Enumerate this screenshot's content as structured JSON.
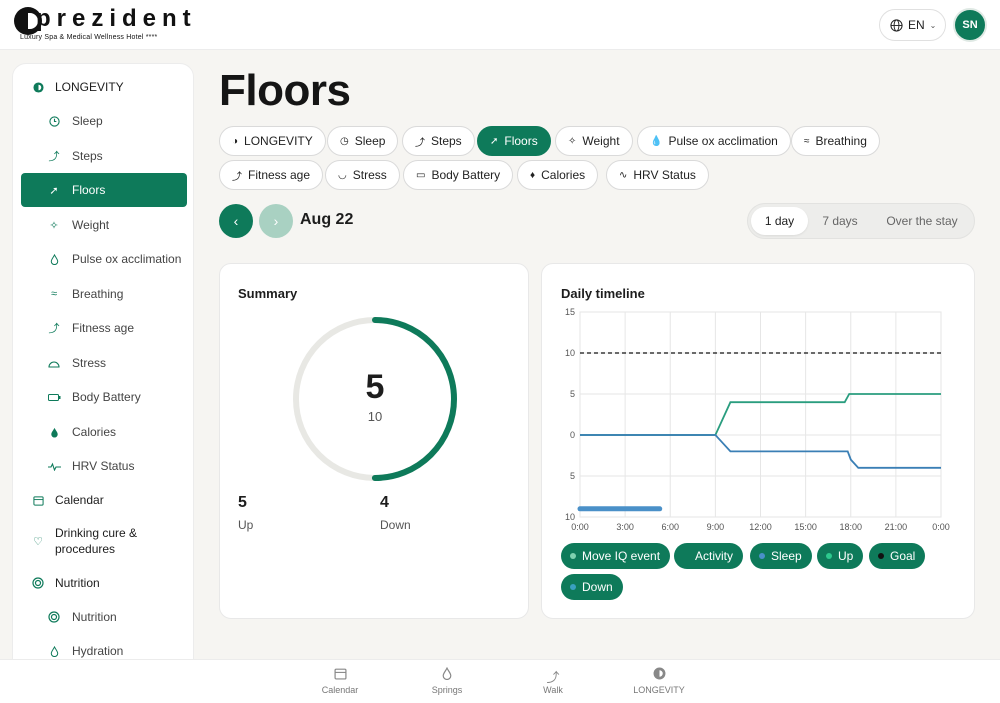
{
  "header": {
    "logo_text": "prezident",
    "tagline": "Luxury Spa & Medical Wellness Hotel ****",
    "language": "EN",
    "avatar_initials": "SN"
  },
  "sidebar": {
    "items": [
      {
        "label": "LONGEVITY",
        "icon": "longevity-icon"
      },
      {
        "label": "Sleep",
        "icon": "clock-icon"
      },
      {
        "label": "Steps",
        "icon": "walk-icon"
      },
      {
        "label": "Floors",
        "icon": "stairs-icon"
      },
      {
        "label": "Weight",
        "icon": "weight-icon"
      },
      {
        "label": "Pulse ox acclimation",
        "icon": "drop-icon"
      },
      {
        "label": "Breathing",
        "icon": "breathing-icon"
      },
      {
        "label": "Fitness age",
        "icon": "runner-icon"
      },
      {
        "label": "Stress",
        "icon": "gauge-icon"
      },
      {
        "label": "Body Battery",
        "icon": "battery-icon"
      },
      {
        "label": "Calories",
        "icon": "flame-icon"
      },
      {
        "label": "HRV Status",
        "icon": "pulse-icon"
      },
      {
        "label": "Calendar",
        "icon": "calendar-icon"
      },
      {
        "label": "Drinking cure & procedures",
        "icon": "heart-icon"
      },
      {
        "label": "Nutrition",
        "icon": "target-icon"
      },
      {
        "label": "Nutrition",
        "icon": "target-icon"
      },
      {
        "label": "Hydration",
        "icon": "drop-icon"
      }
    ]
  },
  "main": {
    "title": "Floors",
    "chips": [
      "LONGEVITY",
      "Sleep",
      "Steps",
      "Floors",
      "Weight",
      "Pulse ox acclimation",
      "Breathing",
      "Fitness age",
      "Stress",
      "Body Battery",
      "Calories",
      "HRV Status"
    ],
    "date": "Aug 22",
    "range_options": [
      "1 day",
      "7 days",
      "Over the stay"
    ],
    "selected_range": "1 day"
  },
  "summary": {
    "title": "Summary",
    "value": "5",
    "goal": "10",
    "progress": 0.5,
    "up_value": "5",
    "up_label": "Up",
    "down_value": "4",
    "down_label": "Down"
  },
  "timeline": {
    "title": "Daily timeline",
    "legend": [
      {
        "label": "Move IQ event",
        "dot": "#7fd1b0"
      },
      {
        "label": "Activity",
        "dot": "#0e7a5a"
      },
      {
        "label": "Sleep",
        "dot": "#4a90c8"
      },
      {
        "label": "Up",
        "dot": "#2dc98e"
      },
      {
        "label": "Goal",
        "dot": "#111111"
      },
      {
        "label": "Down",
        "dot": "#3aa0c0"
      }
    ]
  },
  "chart_data": {
    "type": "line",
    "title": "Daily timeline",
    "x_ticks": [
      "0:00",
      "3:00",
      "6:00",
      "9:00",
      "12:00",
      "15:00",
      "18:00",
      "21:00",
      "0:00"
    ],
    "y_ticks": [
      "15",
      "10",
      "5",
      "0",
      "5",
      "10"
    ],
    "xlim_hours": [
      0,
      24
    ],
    "ylim": [
      -10,
      15
    ],
    "grid": true,
    "series": [
      {
        "name": "Up",
        "color": "#2a9d7f",
        "points": [
          [
            0,
            0
          ],
          [
            9,
            0
          ],
          [
            10,
            4
          ],
          [
            17.6,
            4
          ],
          [
            17.9,
            5
          ],
          [
            24,
            5
          ]
        ]
      },
      {
        "name": "Down",
        "color": "#3a7fb5",
        "points": [
          [
            0,
            0
          ],
          [
            9,
            0
          ],
          [
            9.5,
            -1
          ],
          [
            10,
            -2
          ],
          [
            17.8,
            -2
          ],
          [
            18,
            -3
          ],
          [
            18.5,
            -4
          ],
          [
            24,
            -4
          ]
        ]
      },
      {
        "name": "Goal",
        "color": "#111111",
        "dashed": true,
        "points": [
          [
            0,
            10
          ],
          [
            24,
            10
          ]
        ]
      },
      {
        "name": "Sleep",
        "color": "#4a90c8",
        "bar": true,
        "from": 0,
        "to": 5.3,
        "y": -9
      }
    ]
  },
  "bottom_nav": [
    {
      "label": "Calendar",
      "icon": "calendar-icon"
    },
    {
      "label": "Springs",
      "icon": "drop-icon"
    },
    {
      "label": "Walk",
      "icon": "walk-icon"
    },
    {
      "label": "LONGEVITY",
      "icon": "longevity-icon"
    }
  ]
}
